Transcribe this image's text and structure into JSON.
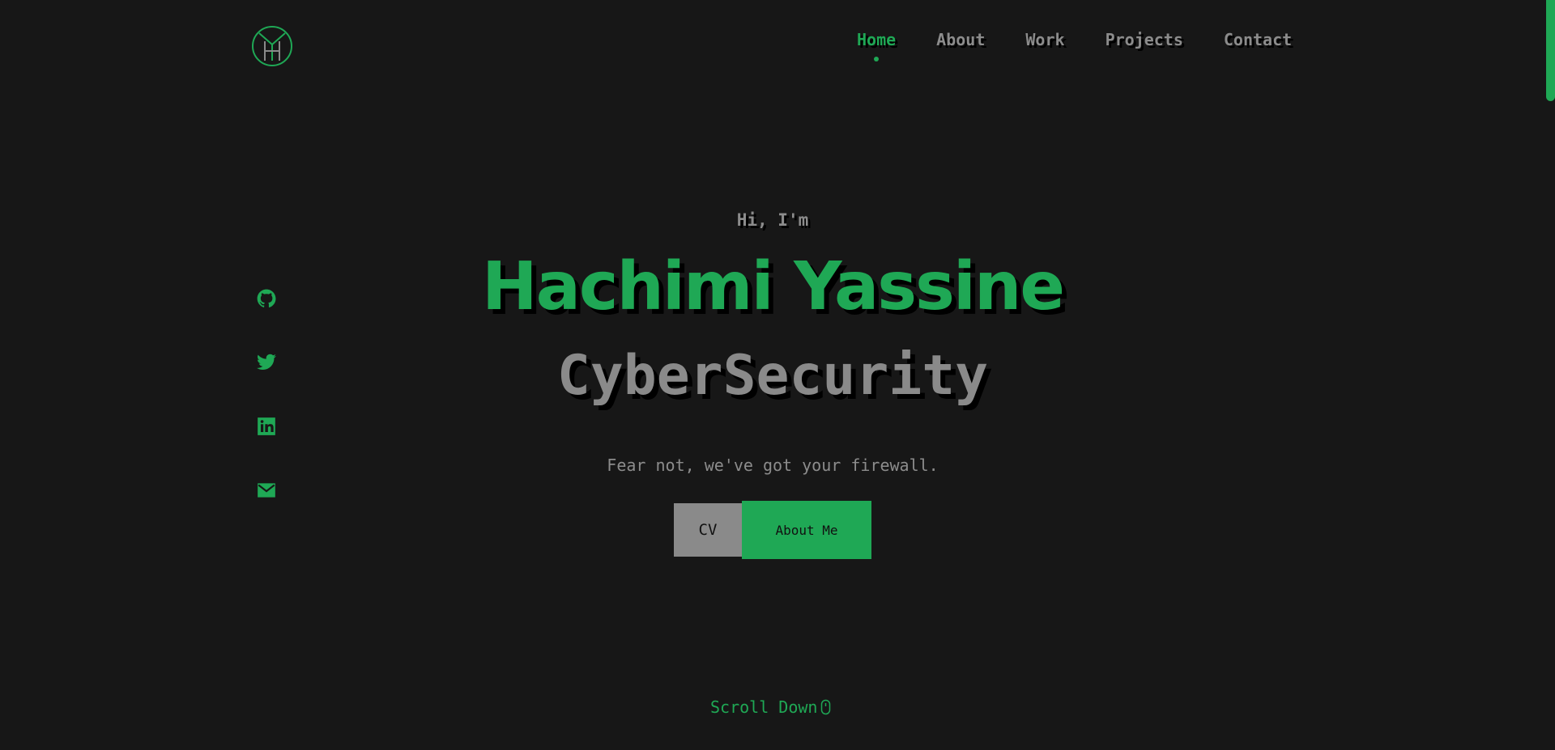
{
  "header": {
    "logo_name": "monogram-logo",
    "nav": [
      {
        "label": "Home",
        "active": true
      },
      {
        "label": "About",
        "active": false
      },
      {
        "label": "Work",
        "active": false
      },
      {
        "label": "Projects",
        "active": false
      },
      {
        "label": "Contact",
        "active": false
      }
    ]
  },
  "social": [
    {
      "icon": "github-icon"
    },
    {
      "icon": "twitter-icon"
    },
    {
      "icon": "linkedin-icon"
    },
    {
      "icon": "email-icon"
    }
  ],
  "hero": {
    "greeting": "Hi, I'm",
    "name": "Hachimi Yassine",
    "role": "CyberSecurity",
    "tagline": "Fear not, we've got your firewall.",
    "cv_label": "CV",
    "about_label": "About Me"
  },
  "scroll": {
    "label": "Scroll Down",
    "icon": "mouse-icon"
  },
  "colors": {
    "background": "#171717",
    "accent": "#1fa855",
    "text": "#8a8a8a"
  }
}
